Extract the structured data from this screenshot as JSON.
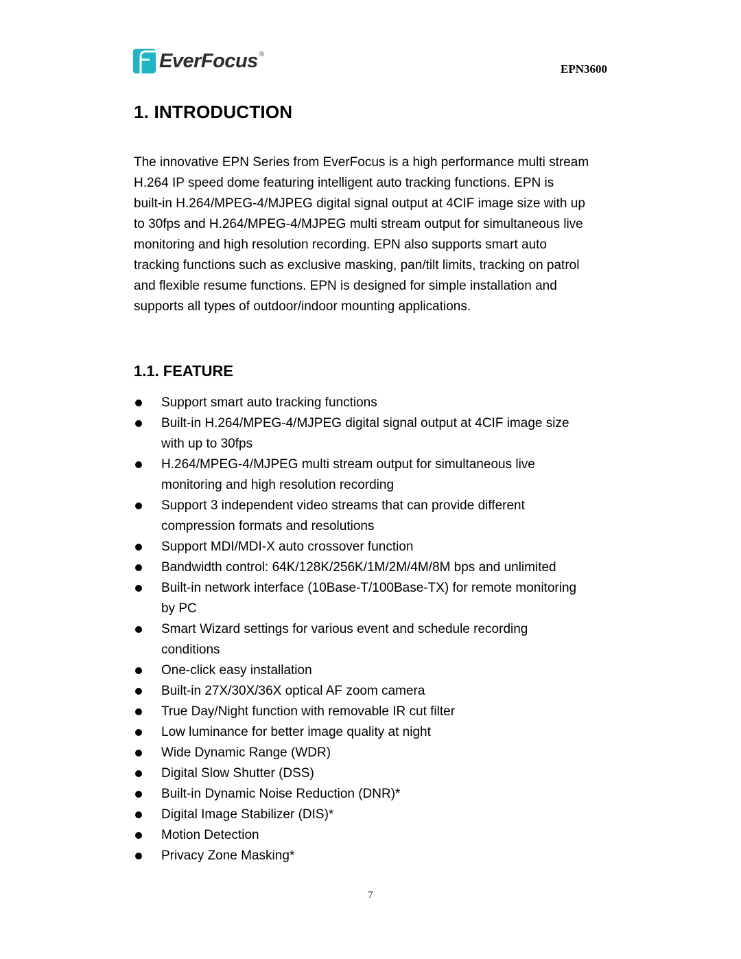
{
  "header": {
    "brand": "EverFocus",
    "registered_mark": "®",
    "brand_color": "#1fb4c8",
    "logo_icon": "everfocus-logo-icon",
    "model": "EPN3600"
  },
  "section": {
    "title": "1.  INTRODUCTION",
    "intro_lines": [
      "The innovative EPN Series from EverFocus is a high performance multi stream",
      "H.264 IP speed dome featuring intelligent auto tracking functions. EPN is",
      "built-in H.264/MPEG-4/MJPEG digital signal output at 4CIF image size with up",
      "to 30fps and H.264/MPEG-4/MJPEG multi stream output for simultaneous live",
      "monitoring and high resolution recording. EPN also supports smart auto",
      "tracking functions such as exclusive masking, pan/tilt limits, tracking on patrol",
      "and flexible resume functions. EPN is designed for simple installation and",
      "supports all types of outdoor/indoor mounting applications."
    ]
  },
  "subsection": {
    "title": "1.1. FEATURE",
    "features": [
      {
        "lines": [
          "Support smart auto tracking functions"
        ]
      },
      {
        "lines": [
          "Built-in H.264/MPEG-4/MJPEG digital signal output at 4CIF image size",
          "with up to 30fps"
        ]
      },
      {
        "lines": [
          "H.264/MPEG-4/MJPEG multi stream output for simultaneous live",
          "monitoring and high resolution recording"
        ]
      },
      {
        "lines": [
          "Support 3 independent video streams that can provide different",
          "compression formats and resolutions"
        ]
      },
      {
        "lines": [
          "Support MDI/MDI-X auto crossover function"
        ]
      },
      {
        "lines": [
          "Bandwidth control: 64K/128K/256K/1M/2M/4M/8M bps and unlimited"
        ]
      },
      {
        "lines": [
          "Built-in network interface (10Base-T/100Base-TX) for remote monitoring",
          "by PC"
        ]
      },
      {
        "lines": [
          "Smart Wizard settings for various event and schedule recording",
          "conditions"
        ]
      },
      {
        "lines": [
          "One-click easy installation"
        ]
      },
      {
        "lines": [
          "Built-in 27X/30X/36X optical AF zoom camera"
        ]
      },
      {
        "lines": [
          "True Day/Night function with removable IR cut filter"
        ]
      },
      {
        "lines": [
          "Low luminance for better image quality at night"
        ]
      },
      {
        "lines": [
          "Wide Dynamic Range (WDR)"
        ]
      },
      {
        "lines": [
          "Digital Slow Shutter (DSS)"
        ]
      },
      {
        "lines": [
          "Built-in Dynamic Noise Reduction (DNR)*"
        ]
      },
      {
        "lines": [
          "Digital Image Stabilizer (DIS)*"
        ]
      },
      {
        "lines": [
          "Motion Detection"
        ]
      },
      {
        "lines": [
          "Privacy Zone Masking*"
        ]
      }
    ]
  },
  "footer": {
    "page_number": "7"
  }
}
